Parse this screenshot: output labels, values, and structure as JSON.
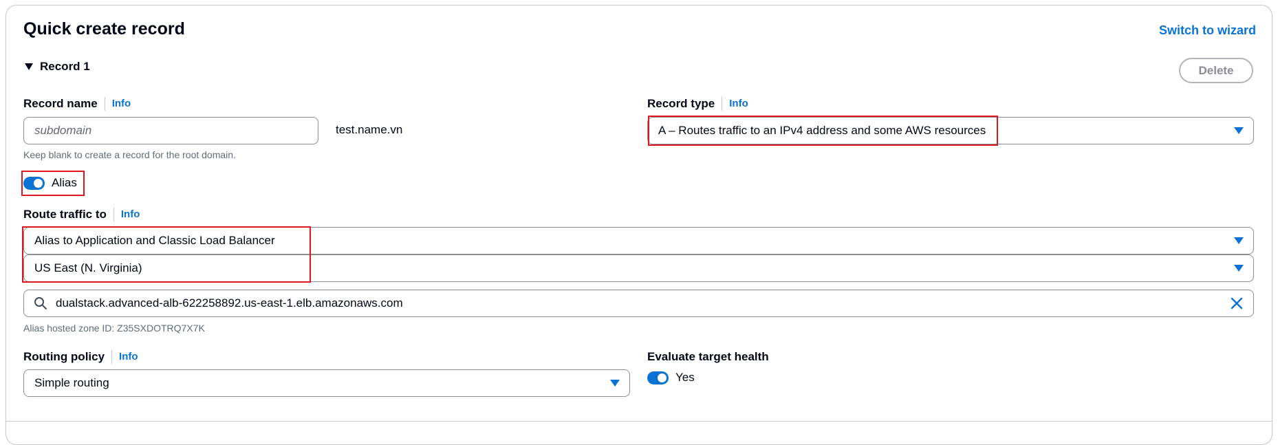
{
  "header": {
    "title": "Quick create record",
    "switch_link": "Switch to wizard"
  },
  "record": {
    "expander_label": "Record 1",
    "delete_label": "Delete"
  },
  "record_name": {
    "label": "Record name",
    "info": "Info",
    "placeholder": "subdomain",
    "value": "",
    "domain_suffix": "test.name.vn",
    "hint": "Keep blank to create a record for the root domain."
  },
  "record_type": {
    "label": "Record type",
    "info": "Info",
    "selected": "A – Routes traffic to an IPv4 address and some AWS resources"
  },
  "alias": {
    "label": "Alias",
    "enabled": true
  },
  "route_traffic": {
    "label": "Route traffic to",
    "info": "Info",
    "endpoint_selected": "Alias to Application and Classic Load Balancer",
    "region_selected": "US East (N. Virginia)",
    "search_value": "dualstack.advanced-alb-622258892.us-east-1.elb.amazonaws.com",
    "hosted_zone_hint": "Alias hosted zone ID: Z35SXDOTRQ7X7K"
  },
  "routing_policy": {
    "label": "Routing policy",
    "info": "Info",
    "selected": "Simple routing"
  },
  "evaluate_health": {
    "label": "Evaluate target health",
    "value_label": "Yes",
    "enabled": true
  },
  "colors": {
    "accent": "#0972d3",
    "highlight": "#e0161e",
    "border": "#8c8c94",
    "text": "#000716"
  },
  "icons": [
    "triangle-down-icon",
    "caret-down-icon",
    "search-icon",
    "clear-x-icon",
    "toggle-switch-icon"
  ]
}
